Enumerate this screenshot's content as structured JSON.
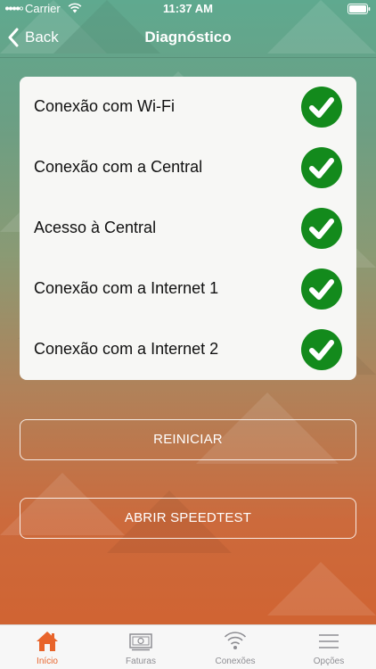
{
  "status_bar": {
    "carrier": "Carrier",
    "time": "11:37 AM"
  },
  "nav": {
    "back_label": "Back",
    "title": "Diagnóstico"
  },
  "diagnostics": [
    {
      "label": "Conexão com Wi-Fi",
      "status": "ok"
    },
    {
      "label": "Conexão com a Central",
      "status": "ok"
    },
    {
      "label": "Acesso à Central",
      "status": "ok"
    },
    {
      "label": "Conexão com a Internet 1",
      "status": "ok"
    },
    {
      "label": "Conexão com a Internet 2",
      "status": "ok"
    }
  ],
  "actions": {
    "restart_label": "REINICIAR",
    "speedtest_label": "ABRIR SPEEDTEST"
  },
  "tabs": [
    {
      "label": "Início",
      "icon": "home-icon",
      "active": true
    },
    {
      "label": "Faturas",
      "icon": "bill-icon",
      "active": false
    },
    {
      "label": "Conexões",
      "icon": "wifi-icon",
      "active": false
    },
    {
      "label": "Opções",
      "icon": "menu-icon",
      "active": false
    }
  ],
  "colors": {
    "check_green": "#138a1c",
    "tab_active": "#e8642b",
    "tab_inactive": "#8e8e93"
  }
}
